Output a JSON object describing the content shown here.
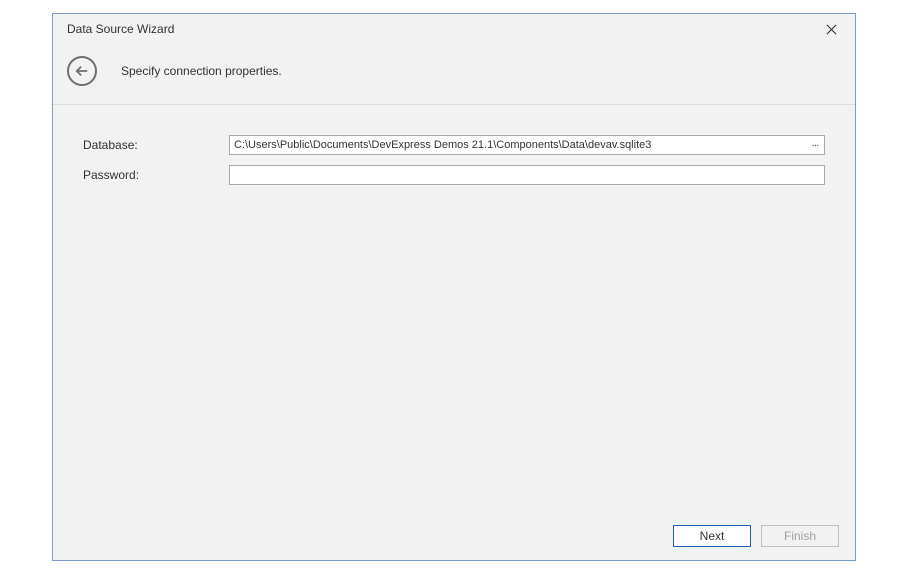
{
  "window": {
    "title": "Data Source Wizard"
  },
  "header": {
    "stepTitle": "Specify connection properties."
  },
  "form": {
    "database": {
      "label": "Database:",
      "value": "C:\\Users\\Public\\Documents\\DevExpress Demos 21.1\\Components\\Data\\devav.sqlite3",
      "browseGlyph": "···"
    },
    "password": {
      "label": "Password:",
      "value": ""
    }
  },
  "footer": {
    "next": "Next",
    "finish": "Finish"
  }
}
